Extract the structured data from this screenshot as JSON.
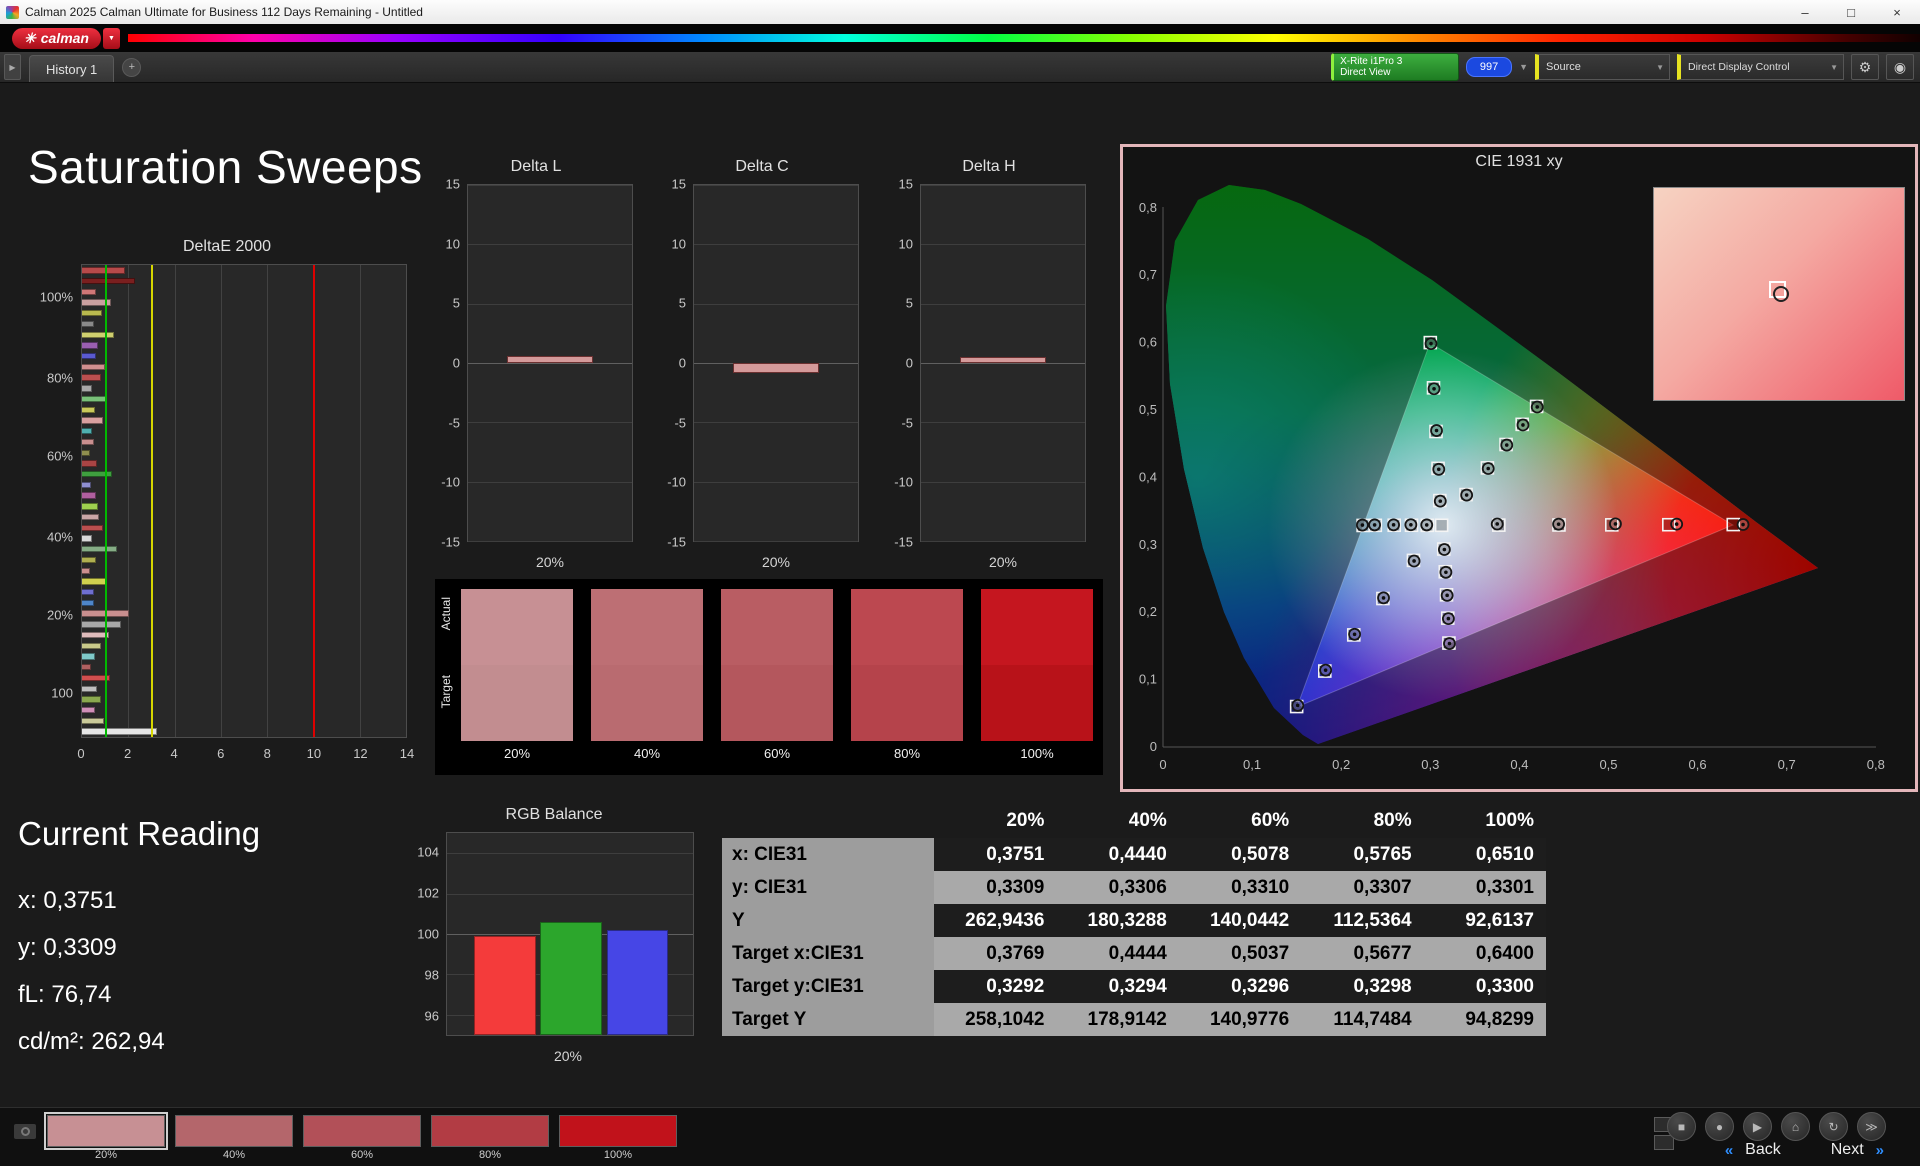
{
  "window": {
    "title": "Calman 2025 Calman Ultimate for Business 112 Days Remaining  - Untitled",
    "minimize": "–",
    "maximize": "□",
    "close": "×"
  },
  "brand": {
    "logo_glyph": "✳",
    "logo_text": "calman",
    "chevron": "▼"
  },
  "toolbar": {
    "expander": "▶",
    "history_tab": "History 1",
    "add_tab": "+",
    "device_line1": "X-Rite i1Pro 3",
    "device_line2": "Direct View",
    "badge": "997",
    "chevron": "▼",
    "source_dropdown": "Source",
    "display_dropdown": "Direct Display Control",
    "gear": "⚙",
    "power": "◉"
  },
  "page": {
    "title": "Saturation Sweeps"
  },
  "current_reading": {
    "title": "Current Reading",
    "lines": [
      "x: 0,3751",
      "y: 0,3309",
      "fL: 76,74",
      "cd/m²: 262,94"
    ]
  },
  "sweep_swatches": {
    "actual_label": "Actual",
    "target_label": "Target",
    "items": [
      {
        "pct": "20%",
        "actual": "#c79094",
        "target": "#c28d90"
      },
      {
        "pct": "40%",
        "actual": "#bd6f74",
        "target": "#b96b70"
      },
      {
        "pct": "60%",
        "actual": "#b95d63",
        "target": "#b4575d"
      },
      {
        "pct": "80%",
        "actual": "#bc4850",
        "target": "#b5434b"
      },
      {
        "pct": "100%",
        "actual": "#c5161f",
        "target": "#b81219"
      }
    ]
  },
  "bottom": {
    "back_icon": "«",
    "back": "Back",
    "next": "Next",
    "next_icon": "»",
    "swatches": [
      {
        "pct": "20%",
        "color": "#c79094"
      },
      {
        "pct": "40%",
        "color": "#b4666b"
      },
      {
        "pct": "60%",
        "color": "#b25058"
      },
      {
        "pct": "80%",
        "color": "#b23c44"
      },
      {
        "pct": "100%",
        "color": "#c1121b"
      }
    ],
    "transport": [
      {
        "name": "stop",
        "glyph": "■"
      },
      {
        "name": "record",
        "glyph": "●"
      },
      {
        "name": "play",
        "glyph": "▶"
      },
      {
        "name": "home",
        "glyph": "⌂"
      },
      {
        "name": "refresh",
        "glyph": "↻"
      },
      {
        "name": "skip",
        "glyph": "≫"
      }
    ]
  },
  "chart_data": [
    {
      "type": "bar",
      "orientation": "horizontal",
      "title": "DeltaE 2000",
      "xlim": [
        0,
        14
      ],
      "xticks": [
        0,
        2,
        4,
        6,
        8,
        10,
        12,
        14
      ],
      "ylabels": [
        {
          "label": "100%",
          "pos": 0.07
        },
        {
          "label": "80%",
          "pos": 0.24
        },
        {
          "label": "60%",
          "pos": 0.405
        },
        {
          "label": "40%",
          "pos": 0.575
        },
        {
          "label": "20%",
          "pos": 0.74
        },
        {
          "label": "100",
          "pos": 0.905
        }
      ],
      "ref_lines": [
        {
          "x": 1,
          "color": "#00b800"
        },
        {
          "x": 3,
          "color": "#d6d600"
        },
        {
          "x": 10,
          "color": "#dd0000"
        }
      ],
      "bars": [
        {
          "c": "#b84a4a",
          "v": 1.85
        },
        {
          "c": "#7a1f1f",
          "v": 2.3
        },
        {
          "c": "#d07777",
          "v": 0.6
        },
        {
          "c": "#caa0a0",
          "v": 1.25
        },
        {
          "c": "#b9b94f",
          "v": 0.85
        },
        {
          "c": "#8a8a8a",
          "v": 0.5
        },
        {
          "c": "#cfcf6f",
          "v": 1.4
        },
        {
          "c": "#9a5fb0",
          "v": 0.7
        },
        {
          "c": "#5a5ad0",
          "v": 0.6
        },
        {
          "c": "#d08f8f",
          "v": 1.0
        },
        {
          "c": "#bb4f4f",
          "v": 0.8
        },
        {
          "c": "#a8a8a8",
          "v": 0.45
        },
        {
          "c": "#79c079",
          "v": 1.1
        },
        {
          "c": "#c9c95a",
          "v": 0.55
        },
        {
          "c": "#d9a0a0",
          "v": 0.9
        },
        {
          "c": "#4fb0b0",
          "v": 0.45
        },
        {
          "c": "#c98f8f",
          "v": 0.5
        },
        {
          "c": "#8f8f4f",
          "v": 0.35
        },
        {
          "c": "#aa4444",
          "v": 0.65
        },
        {
          "c": "#3f9f3f",
          "v": 1.3
        },
        {
          "c": "#8f8fd0",
          "v": 0.4
        },
        {
          "c": "#b05f9f",
          "v": 0.6
        },
        {
          "c": "#9fd04f",
          "v": 0.7
        },
        {
          "c": "#caa6a6",
          "v": 0.75
        },
        {
          "c": "#bb4f4f",
          "v": 0.9
        },
        {
          "c": "#d9d9d9",
          "v": 0.45
        },
        {
          "c": "#86ad86",
          "v": 1.5
        },
        {
          "c": "#b0b050",
          "v": 0.6
        },
        {
          "c": "#cc8f8f",
          "v": 0.35
        },
        {
          "c": "#d0d04f",
          "v": 1.05
        },
        {
          "c": "#6f6fd0",
          "v": 0.5
        },
        {
          "c": "#4f86c9",
          "v": 0.5
        },
        {
          "c": "#c98f8f",
          "v": 2.05
        },
        {
          "c": "#a8a8a8",
          "v": 1.7
        },
        {
          "c": "#debbbb",
          "v": 1.15
        },
        {
          "c": "#c9c98a",
          "v": 0.8
        },
        {
          "c": "#7fc9c9",
          "v": 0.55
        },
        {
          "c": "#b06060",
          "v": 0.4
        },
        {
          "c": "#d04f4f",
          "v": 1.2
        },
        {
          "c": "#bfbfbf",
          "v": 0.65
        },
        {
          "c": "#8aa84f",
          "v": 0.8
        },
        {
          "c": "#d08fb8",
          "v": 0.55
        },
        {
          "c": "#caca9a",
          "v": 0.95
        },
        {
          "c": "#e6e6e6",
          "v": 3.25
        }
      ]
    },
    {
      "type": "bar",
      "title": "Delta L",
      "categories": [
        "20%"
      ],
      "values": [
        0.55
      ],
      "ylim": [
        -15,
        15
      ],
      "yticks": [
        15,
        10,
        5,
        0,
        -5,
        -10,
        -15
      ]
    },
    {
      "type": "bar",
      "title": "Delta C",
      "categories": [
        "20%"
      ],
      "values": [
        -0.85
      ],
      "ylim": [
        -15,
        15
      ],
      "yticks": [
        15,
        10,
        5,
        0,
        -5,
        -10,
        -15
      ]
    },
    {
      "type": "bar",
      "title": "Delta H",
      "categories": [
        "20%"
      ],
      "values": [
        0.5
      ],
      "ylim": [
        -15,
        15
      ],
      "yticks": [
        15,
        10,
        5,
        0,
        -5,
        -10,
        -15
      ]
    },
    {
      "type": "bar",
      "title": "RGB Balance",
      "categories": [
        "20%"
      ],
      "ylim": [
        95,
        105
      ],
      "yticks": [
        104,
        102,
        100,
        98,
        96
      ],
      "series": [
        {
          "name": "Red",
          "values": [
            99.9
          ],
          "color": "#f43b3b"
        },
        {
          "name": "Green",
          "values": [
            100.6
          ],
          "color": "#2ca62c"
        },
        {
          "name": "Blue",
          "values": [
            100.2
          ],
          "color": "#4646e6"
        }
      ]
    },
    {
      "type": "scatter",
      "title": "CIE 1931 xy",
      "xlim": [
        0,
        0.8
      ],
      "ylim": [
        0,
        0.85
      ],
      "xticks": [
        "0",
        "0,1",
        "0,2",
        "0,3",
        "0,4",
        "0,5",
        "0,6",
        "0,7",
        "0,8"
      ],
      "yticks": [
        "0",
        "0,1",
        "0,2",
        "0,3",
        "0,4",
        "0,5",
        "0,6",
        "0,7",
        "0,8"
      ],
      "white_target": [
        0.3127,
        0.329
      ],
      "inset_point": [
        0.46,
        0.44
      ],
      "sweeps": [
        {
          "name": "red",
          "targets": [
            [
              0.3769,
              0.3292
            ],
            [
              0.4444,
              0.3294
            ],
            [
              0.5037,
              0.3296
            ],
            [
              0.5677,
              0.3298
            ],
            [
              0.64,
              0.33
            ]
          ],
          "actuals": [
            [
              0.3751,
              0.3309
            ],
            [
              0.444,
              0.3306
            ],
            [
              0.5078,
              0.331
            ],
            [
              0.5765,
              0.3307
            ],
            [
              0.651,
              0.3301
            ]
          ]
        },
        {
          "name": "green",
          "targets": [
            [
              0.3107,
              0.3656
            ],
            [
              0.3087,
              0.4134
            ],
            [
              0.3064,
              0.4681
            ],
            [
              0.3036,
              0.5329
            ],
            [
              0.3,
              0.6
            ]
          ],
          "actuals": [
            [
              0.3112,
              0.3648
            ],
            [
              0.3095,
              0.412
            ],
            [
              0.307,
              0.4695
            ],
            [
              0.3042,
              0.5315
            ],
            [
              0.3008,
              0.5985
            ]
          ]
        },
        {
          "name": "blue",
          "targets": [
            [
              0.2811,
              0.2769
            ],
            [
              0.2468,
              0.2203
            ],
            [
              0.2141,
              0.1663
            ],
            [
              0.1816,
              0.1127
            ],
            [
              0.15,
              0.06
            ]
          ],
          "actuals": [
            [
              0.2818,
              0.276
            ],
            [
              0.2475,
              0.2212
            ],
            [
              0.215,
              0.1672
            ],
            [
              0.1825,
              0.114
            ],
            [
              0.1512,
              0.0618
            ]
          ]
        },
        {
          "name": "yellow",
          "targets": [
            [
              0.3401,
              0.3745
            ],
            [
              0.3641,
              0.4141
            ],
            [
              0.385,
              0.4488
            ],
            [
              0.4031,
              0.4787
            ],
            [
              0.4193,
              0.5053
            ]
          ],
          "actuals": [
            [
              0.3408,
              0.3738
            ],
            [
              0.365,
              0.4132
            ],
            [
              0.3858,
              0.448
            ],
            [
              0.404,
              0.4778
            ],
            [
              0.42,
              0.5045
            ]
          ]
        },
        {
          "name": "cyan",
          "targets": [
            [
              0.2966,
              0.3289
            ],
            [
              0.2789,
              0.329
            ],
            [
              0.2595,
              0.329
            ],
            [
              0.2383,
              0.3289
            ],
            [
              0.2246,
              0.3287
            ]
          ],
          "actuals": [
            [
              0.296,
              0.3295
            ],
            [
              0.2782,
              0.3297
            ],
            [
              0.2588,
              0.3296
            ],
            [
              0.2375,
              0.3295
            ],
            [
              0.2238,
              0.3293
            ]
          ]
        },
        {
          "name": "magenta",
          "targets": [
            [
              0.3151,
              0.2937
            ],
            [
              0.3168,
              0.26
            ],
            [
              0.3182,
              0.2258
            ],
            [
              0.3196,
              0.1912
            ],
            [
              0.3209,
              0.1542
            ]
          ],
          "actuals": [
            [
              0.3158,
              0.293
            ],
            [
              0.3175,
              0.2592
            ],
            [
              0.3189,
              0.225
            ],
            [
              0.3203,
              0.1905
            ],
            [
              0.3215,
              0.1535
            ]
          ]
        }
      ]
    },
    {
      "type": "table",
      "columns": [
        "",
        "20%",
        "40%",
        "60%",
        "80%",
        "100%"
      ],
      "rows": [
        {
          "label": "x: CIE31",
          "values": [
            "0,3751",
            "0,4440",
            "0,5078",
            "0,5765",
            "0,6510"
          ],
          "shade": "dark"
        },
        {
          "label": "y: CIE31",
          "values": [
            "0,3309",
            "0,3306",
            "0,3310",
            "0,3307",
            "0,3301"
          ],
          "shade": "light"
        },
        {
          "label": "Y",
          "values": [
            "262,9436",
            "180,3288",
            "140,0442",
            "112,5364",
            "92,6137"
          ],
          "shade": "dark"
        },
        {
          "label": "Target x:CIE31",
          "values": [
            "0,3769",
            "0,4444",
            "0,5037",
            "0,5677",
            "0,6400"
          ],
          "shade": "light"
        },
        {
          "label": "Target y:CIE31",
          "values": [
            "0,3292",
            "0,3294",
            "0,3296",
            "0,3298",
            "0,3300"
          ],
          "shade": "dark"
        },
        {
          "label": "Target Y",
          "values": [
            "258,1042",
            "178,9142",
            "140,9776",
            "114,7484",
            "94,8299"
          ],
          "shade": "light"
        }
      ]
    }
  ]
}
